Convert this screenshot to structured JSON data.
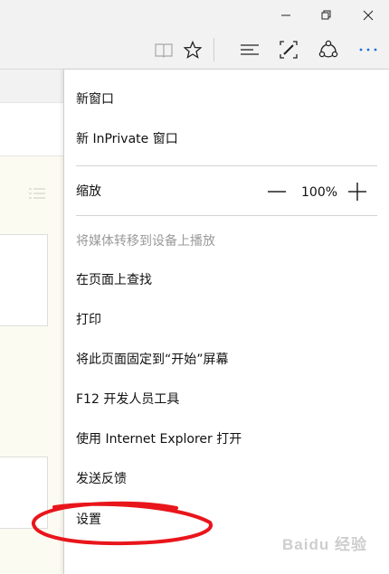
{
  "window_controls": {
    "minimize": "—",
    "restore": "❐",
    "close": "✕"
  },
  "toolbar": {
    "icons": [
      "reading-view-icon",
      "favorite-star-icon",
      "hub-icon",
      "web-note-icon",
      "share-icon",
      "more-actions-icon"
    ]
  },
  "menu": {
    "new_window": "新窗口",
    "new_inprivate_window": "新 InPrivate 窗口",
    "zoom_label": "缩放",
    "zoom_value": "100%",
    "cast_media": "将媒体转移到设备上播放",
    "find_on_page": "在页面上查找",
    "print": "打印",
    "pin_to_start": "将此页面固定到“开始”屏幕",
    "f12_tools": "F12 开发人员工具",
    "open_with_ie": "使用 Internet Explorer 打开",
    "send_feedback": "发送反馈",
    "settings": "设置"
  },
  "annotation": {
    "color": "#e8161b"
  },
  "watermark": {
    "text": "Baidu 经验"
  }
}
